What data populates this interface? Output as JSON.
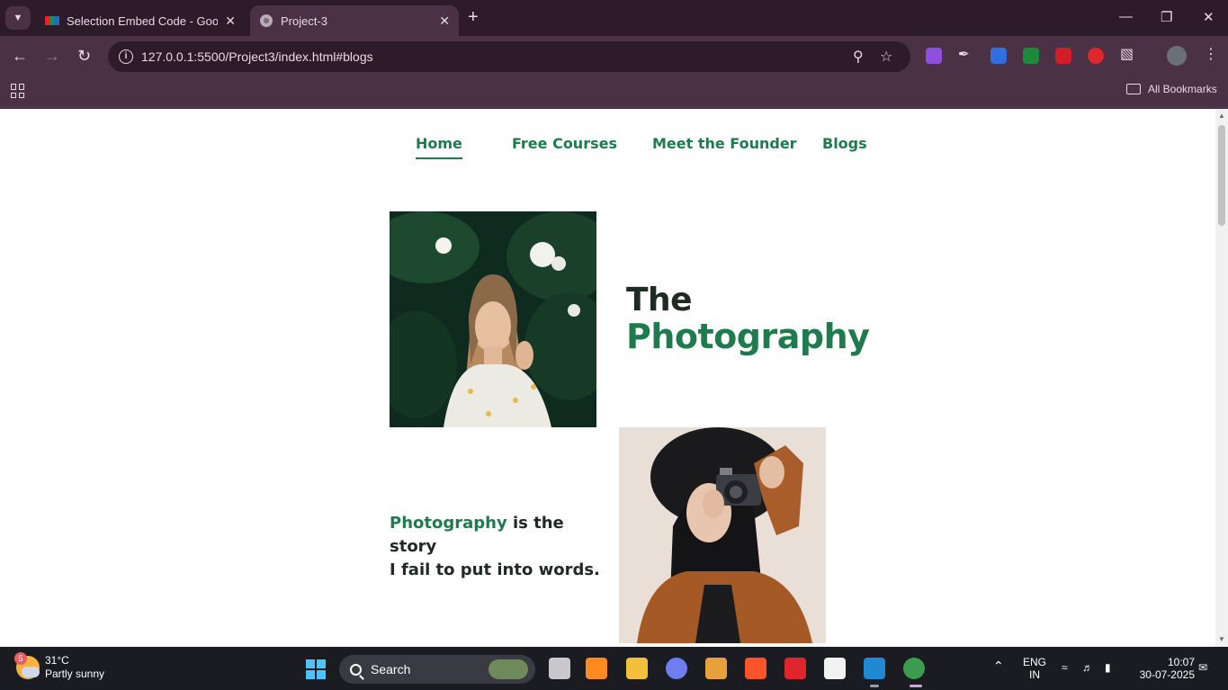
{
  "browser": {
    "tabs": [
      {
        "title": "Selection Embed Code - Google",
        "active": false
      },
      {
        "title": "Project-3",
        "active": true
      }
    ],
    "url": "127.0.0.1:5500/Project3/index.html#blogs",
    "bookmarks_label": "All Bookmarks"
  },
  "site": {
    "nav": [
      {
        "label": "Home",
        "active": true
      },
      {
        "label": "Free Courses"
      },
      {
        "label": "Meet the Founder"
      },
      {
        "label": "Blogs"
      }
    ],
    "hero": {
      "title_line1": "The",
      "title_line2": "Photography"
    },
    "quote": {
      "highlight": "Photography",
      "rest_line1": "is the story",
      "line2": "I fail to put into words."
    }
  },
  "taskbar": {
    "weather_badge": "5",
    "temperature": "31°C",
    "condition": "Partly sunny",
    "search_label": "Search",
    "language_line1": "ENG",
    "language_line2": "IN",
    "time": "10:07",
    "date": "30-07-2025"
  },
  "colors": {
    "accent_green": "#1f7a4d",
    "text_dark": "#1f2a24",
    "browser_frame": "#4a3145"
  }
}
